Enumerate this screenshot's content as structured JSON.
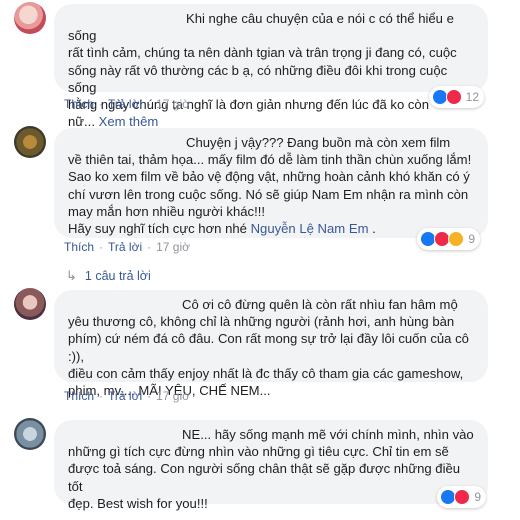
{
  "comments": [
    {
      "text": "Khi nghe câu chuyện của e nói c có thể hiểu e sống\nrất tình cảm, chúng ta nên dành tgian và trân trọng ji đang có, cuộc\nsống này rất vô thường các b ạ, có những điều đôi khi trong cuộc sống\nhằng ngày chúng ta nghĩ là đơn giản nhưng đến lúc đã ko còn\nnữ...",
      "see_more": "Xem thêm",
      "like": "Thích",
      "reply": "Trả lời",
      "time": "17 giờ",
      "reaction_count": "12",
      "reactions": [
        "like-icon",
        "love-icon"
      ]
    },
    {
      "text": "Chuyện j vậy??? Đang buồn mà còn xem film\nvề thiên tai, thảm họa... mấy film đó dễ làm tinh thần chùn xuống lắm!\nSao ko xem film về bảo vệ động vật, những hoàn cảnh khó khăn có ý\nchí vươn lên trong cuộc sống. Nó sẽ giúp Nam Em nhận ra mình còn\nmay mắn hơn nhiều người khác!!!\nHãy suy nghĩ tích cực hơn nhé ",
      "mention": "Nguyễn Lệ Nam Em",
      "after_mention": " .",
      "like": "Thích",
      "reply": "Trả lời",
      "time": "17 giờ",
      "reaction_count": "9",
      "reactions": [
        "like-icon",
        "love-icon",
        "haha-icon"
      ],
      "replies_label": "1 câu trả lời"
    },
    {
      "text": "Cô ơi cô đừng quên là còn rất nhìu fan hâm mộ\nyêu thương cô, không chỉ là những người (rảnh hơi, anh hùng bàn\nphím) cứ ném đá cô đâu. Con rất mong sự trở lại đầy lôi cuốn của cô :)),\nđiều con cảm thấy enjoy nhất là đc thấy cô tham gia các gameshow,\nphim, mv,... MÃI YÊU, CHẾ NEM...",
      "like": "Thích",
      "reply": "Trả lời",
      "time": "17 giờ"
    },
    {
      "text": "NE... hãy sống mạnh mẽ với chính mình, nhìn vào\nnhững gì tích cực đừng nhìn vào những gì tiêu cực. Chỉ tin em sẽ\nđược toả sáng. Con người sống chân thật sẽ gặp được những điều tốt\nđẹp. Best wish for you!!!",
      "reaction_count": "9",
      "reactions": [
        "like-icon",
        "love-icon"
      ]
    }
  ]
}
